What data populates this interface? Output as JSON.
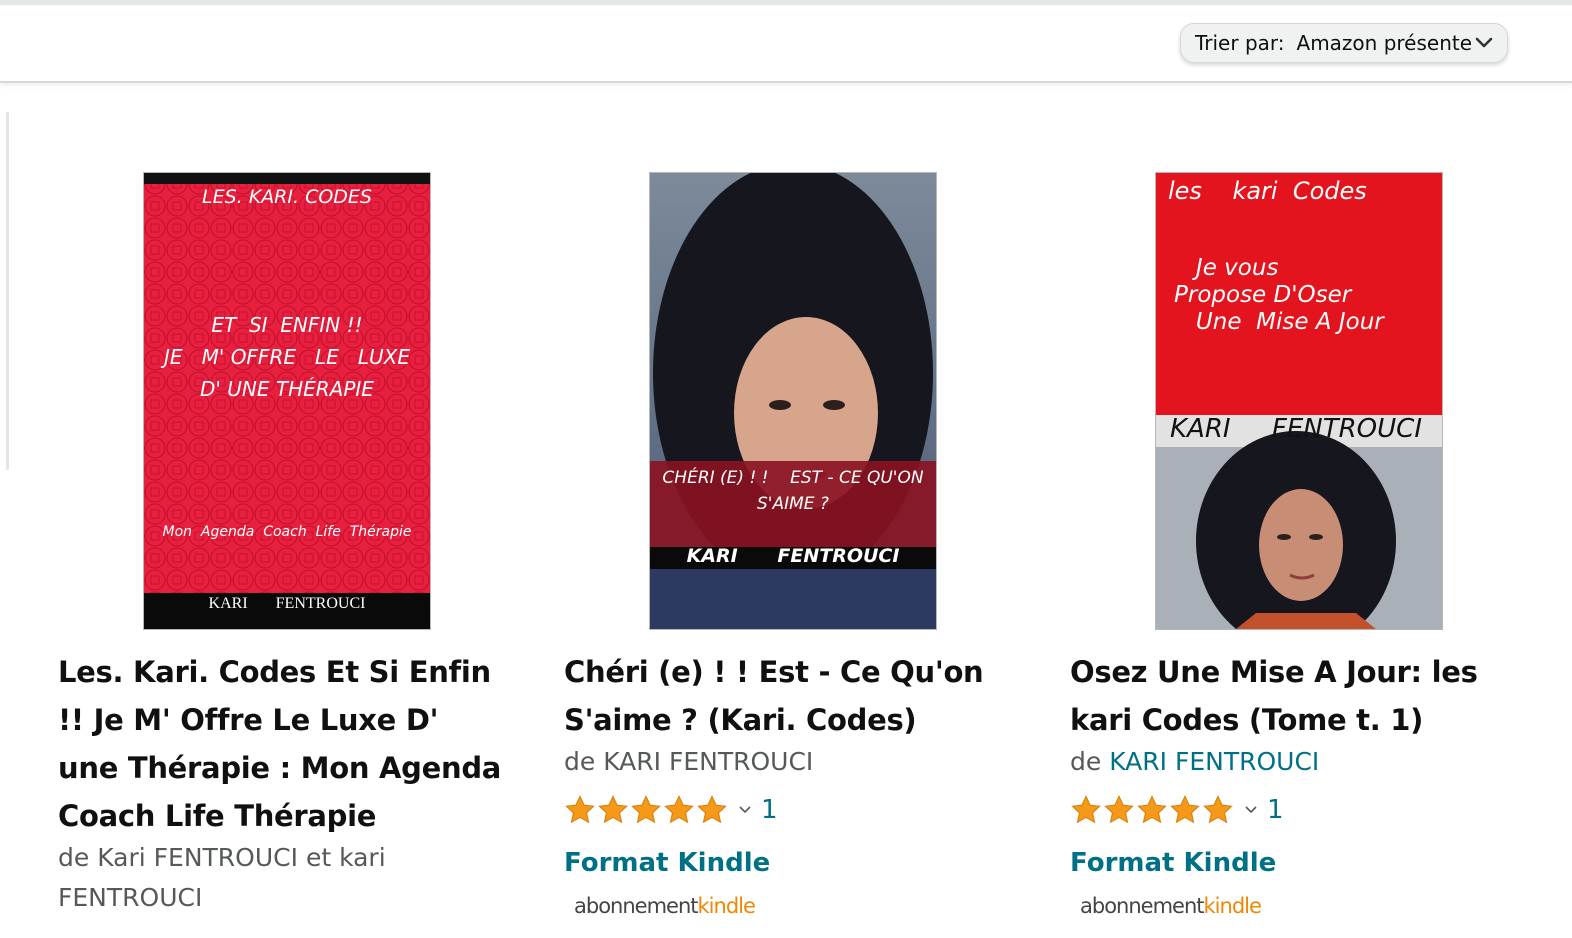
{
  "sort": {
    "label": "Trier par:",
    "value": "Amazon présente"
  },
  "books": [
    {
      "title": "Les. Kari. Codes Et Si Enfin !! Je M' Offre Le Luxe D' une Thérapie : Mon Agenda Coach Life Thérapie",
      "by_prefix": "de",
      "author1": "Kari FENTROUCI",
      "connector": "et",
      "author2": "kari FENTROUCI",
      "cover": {
        "series": "LES. KARI. CODES",
        "headline": "ET  SI  ENFIN !!\nJE   M' OFFRE   LE   LUXE\nD' UNE THÉRAPIE",
        "subtitle": "Mon  Agenda  Coach  Life  Thérapie",
        "author": "KARI       FENTROUCI",
        "bg_color": "#e8203f"
      }
    },
    {
      "title": "Chéri (e) ! ! Est - Ce Qu'on S'aime ? (Kari. Codes)",
      "by_prefix": "de",
      "author1": "KARI FENTROUCI",
      "rating_count": "1",
      "rating_value": 5,
      "format": "Format Kindle",
      "subscription_a": "abonnement",
      "subscription_b": "kindle",
      "cover": {
        "band_text": "CHÉRI (E) ! !    EST - CE QU'ON\nS'AIME ?",
        "author": "KARI      FENTROUCI",
        "band_color": "#8b1221"
      }
    },
    {
      "title": "Osez Une Mise A Jour: les kari Codes (Tome t. 1)",
      "by_prefix": "de",
      "author1": "KARI FENTROUCI",
      "rating_count": "1",
      "rating_value": 5,
      "format": "Format Kindle",
      "subscription_a": "abonnement",
      "subscription_b": "kindle",
      "cover": {
        "series": "les    kari  Codes",
        "headline": "   Je vous\nPropose D'Oser\n   Une  Mise A Jour",
        "author": "KARI     FENTROUCI",
        "bg_color": "#e3141e"
      }
    }
  ],
  "colors": {
    "link": "#007185",
    "star": "#f49918",
    "kindle_orange": "#f08804"
  }
}
